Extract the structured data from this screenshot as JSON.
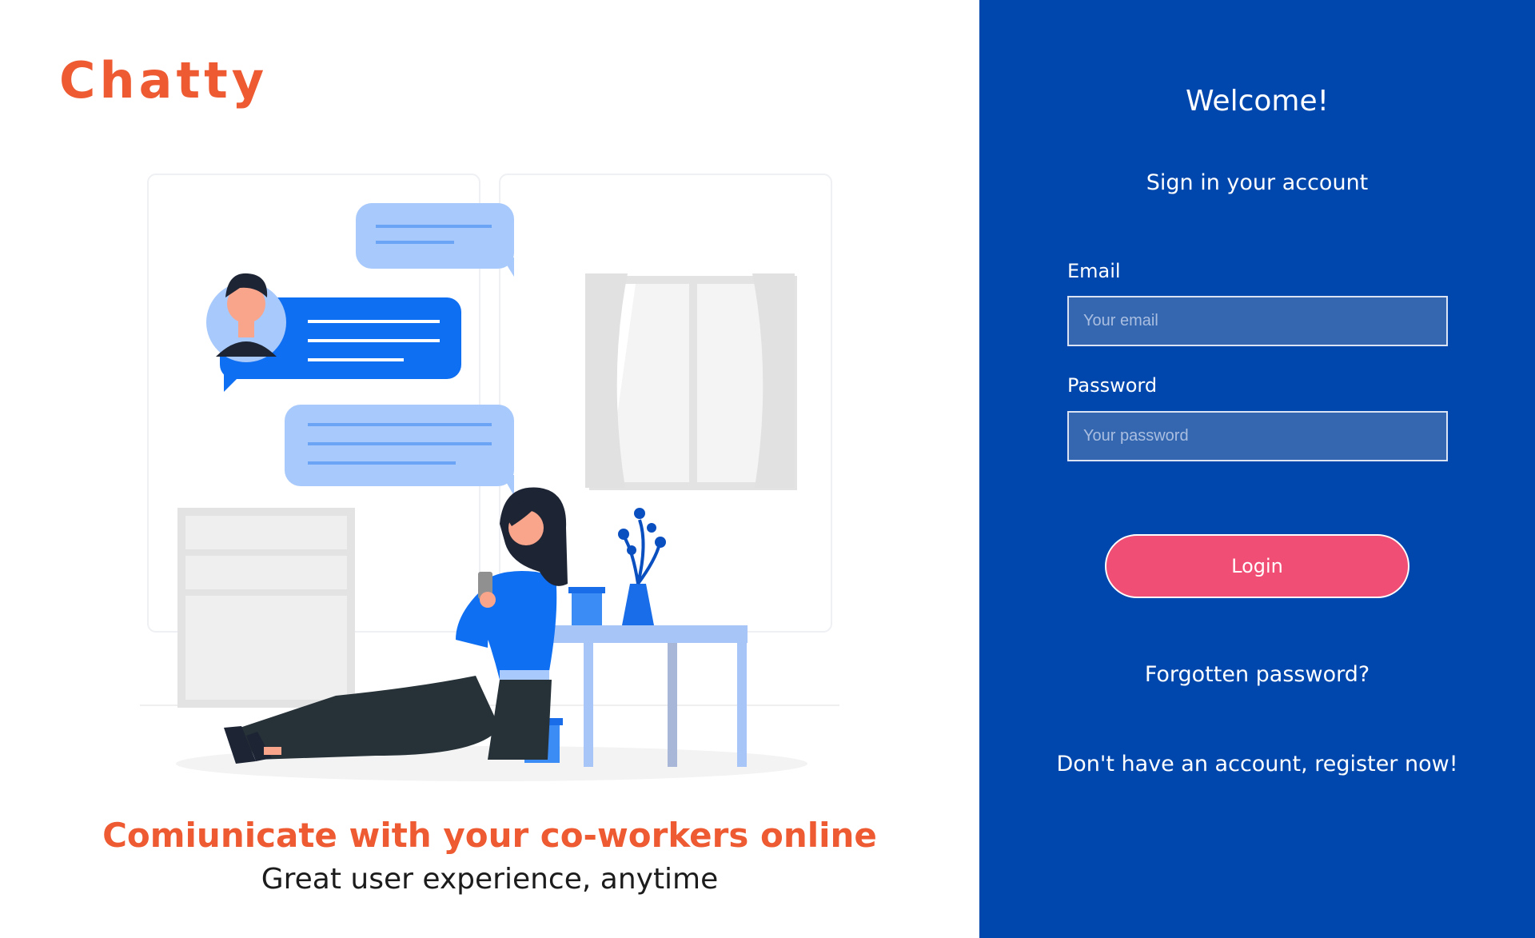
{
  "brand": {
    "logo_text": "Chatty",
    "color": "#ee5a32"
  },
  "hero": {
    "tagline": "Comiunicate with your co-workers online",
    "subtagline": "Great user experience, anytime",
    "illustration": "person-chatting-on-phone-illustration"
  },
  "login": {
    "panel_color": "#0047ad",
    "welcome": "Welcome!",
    "subtitle": "Sign in your account",
    "email_label": "Email",
    "email_placeholder": "Your email",
    "email_value": "",
    "password_label": "Password",
    "password_placeholder": "Your password",
    "password_value": "",
    "login_button": "Login",
    "login_button_color": "#f04e74",
    "forgot_link": "Forgotten password?",
    "register_link": "Don't have an account, register now!"
  }
}
